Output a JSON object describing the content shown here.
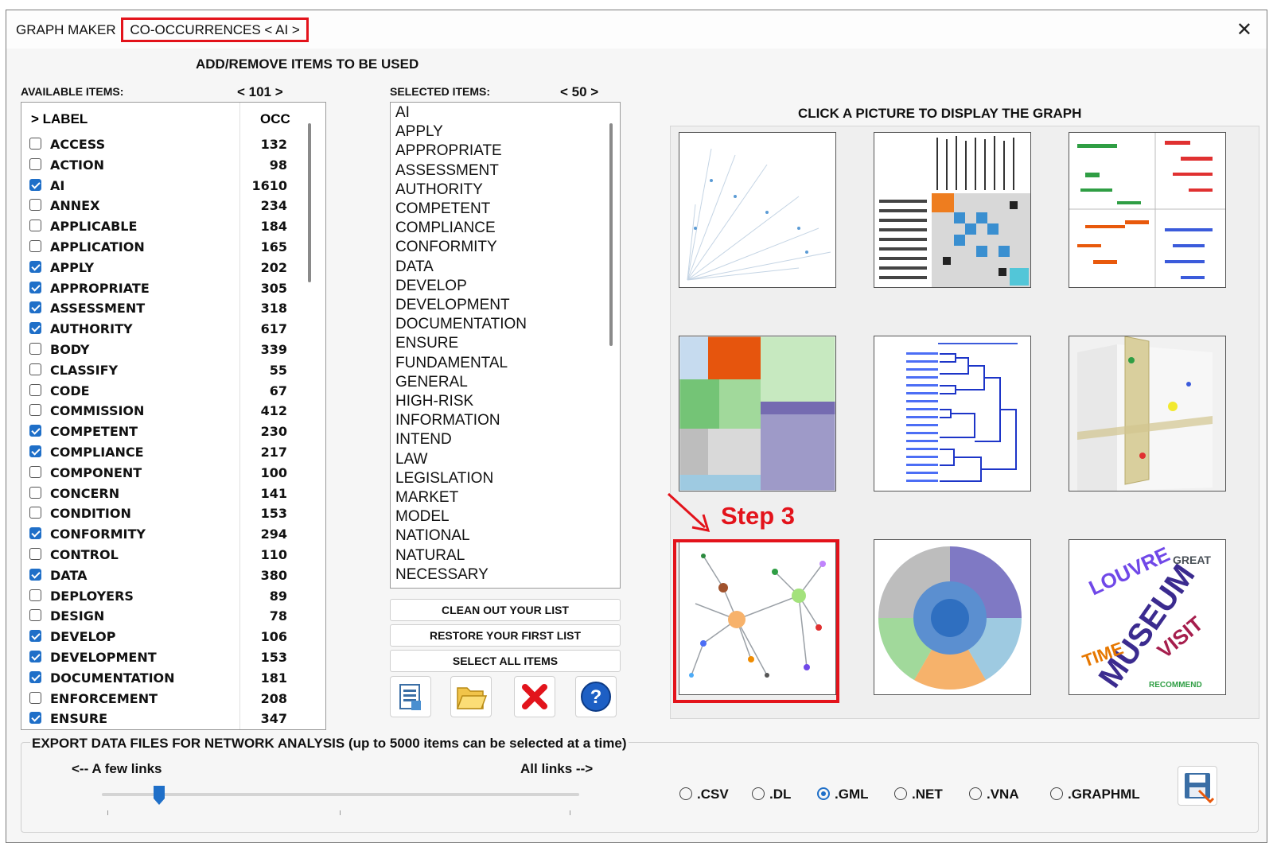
{
  "title": {
    "prefix": "GRAPH MAKER",
    "highlighted": "CO-OCCURRENCES  < AI >"
  },
  "close_glyph": "✕",
  "section_heading": "ADD/REMOVE ITEMS TO BE USED",
  "available": {
    "label": "AVAILABLE ITEMS:",
    "counter": "<  101 >",
    "col_label": "> LABEL",
    "col_occ": "OCC",
    "rows": [
      {
        "label": "ACCESS",
        "occ": "132",
        "checked": false
      },
      {
        "label": "ACTION",
        "occ": "98",
        "checked": false
      },
      {
        "label": "AI",
        "occ": "1610",
        "checked": true
      },
      {
        "label": "ANNEX",
        "occ": "234",
        "checked": false
      },
      {
        "label": "APPLICABLE",
        "occ": "184",
        "checked": false
      },
      {
        "label": "APPLICATION",
        "occ": "165",
        "checked": false
      },
      {
        "label": "APPLY",
        "occ": "202",
        "checked": true
      },
      {
        "label": "APPROPRIATE",
        "occ": "305",
        "checked": true
      },
      {
        "label": "ASSESSMENT",
        "occ": "318",
        "checked": true
      },
      {
        "label": "AUTHORITY",
        "occ": "617",
        "checked": true
      },
      {
        "label": "BODY",
        "occ": "339",
        "checked": false
      },
      {
        "label": "CLASSIFY",
        "occ": "55",
        "checked": false
      },
      {
        "label": "CODE",
        "occ": "67",
        "checked": false
      },
      {
        "label": "COMMISSION",
        "occ": "412",
        "checked": false
      },
      {
        "label": "COMPETENT",
        "occ": "230",
        "checked": true
      },
      {
        "label": "COMPLIANCE",
        "occ": "217",
        "checked": true
      },
      {
        "label": "COMPONENT",
        "occ": "100",
        "checked": false
      },
      {
        "label": "CONCERN",
        "occ": "141",
        "checked": false
      },
      {
        "label": "CONDITION",
        "occ": "153",
        "checked": false
      },
      {
        "label": "CONFORMITY",
        "occ": "294",
        "checked": true
      },
      {
        "label": "CONTROL",
        "occ": "110",
        "checked": false
      },
      {
        "label": "DATA",
        "occ": "380",
        "checked": true
      },
      {
        "label": "DEPLOYERS",
        "occ": "89",
        "checked": false
      },
      {
        "label": "DESIGN",
        "occ": "78",
        "checked": false
      },
      {
        "label": "DEVELOP",
        "occ": "106",
        "checked": true
      },
      {
        "label": "DEVELOPMENT",
        "occ": "153",
        "checked": true
      },
      {
        "label": "DOCUMENTATION",
        "occ": "181",
        "checked": true
      },
      {
        "label": "ENFORCEMENT",
        "occ": "208",
        "checked": false
      },
      {
        "label": "ENSURE",
        "occ": "347",
        "checked": true
      }
    ]
  },
  "selected": {
    "label": "SELECTED ITEMS:",
    "counter": "<  50 >",
    "items": [
      "AI",
      "APPLY",
      "APPROPRIATE",
      "ASSESSMENT",
      "AUTHORITY",
      "COMPETENT",
      "COMPLIANCE",
      "CONFORMITY",
      "DATA",
      "DEVELOP",
      "DEVELOPMENT",
      "DOCUMENTATION",
      "ENSURE",
      "FUNDAMENTAL",
      "GENERAL",
      "HIGH-RISK",
      "INFORMATION",
      "INTEND",
      "LAW",
      "LEGISLATION",
      "MARKET",
      "MODEL",
      "NATIONAL",
      "NATURAL",
      "NECESSARY"
    ]
  },
  "buttons": {
    "clean": "CLEAN OUT YOUR LIST",
    "restore": "RESTORE YOUR FIRST  LIST",
    "select_all": "SELECT ALL ITEMS"
  },
  "icon_buttons": [
    "document-list-icon",
    "folder-open-icon",
    "delete-x-icon",
    "help-icon"
  ],
  "gallery": {
    "heading": "CLICK A PICTURE TO DISPLAY THE GRAPH",
    "step_label": "Step 3",
    "thumbnails": [
      "radial-tree",
      "adjacency-matrix",
      "word-scatter",
      "treemap",
      "dendrogram",
      "3d-scatter",
      "network-graph",
      "sunburst",
      "word-cloud"
    ],
    "selected_thumbnail": "network-graph",
    "highlight_color": "#e3131b"
  },
  "export": {
    "heading": "EXPORT DATA FILES FOR NETWORK ANALYSIS (up to 5000 items can be selected at a time)",
    "left_label": "<-- A few links",
    "right_label": "All links -->",
    "slider_value": 0.12,
    "formats": [
      {
        "label": ".CSV",
        "selected": false
      },
      {
        "label": ".DL",
        "selected": false
      },
      {
        "label": ".GML",
        "selected": true
      },
      {
        "label": ".NET",
        "selected": false
      },
      {
        "label": ".VNA",
        "selected": false
      },
      {
        "label": ".GRAPHML",
        "selected": false
      }
    ]
  },
  "colors": {
    "accent": "#1f6fc8",
    "highlight": "#e3131b"
  }
}
